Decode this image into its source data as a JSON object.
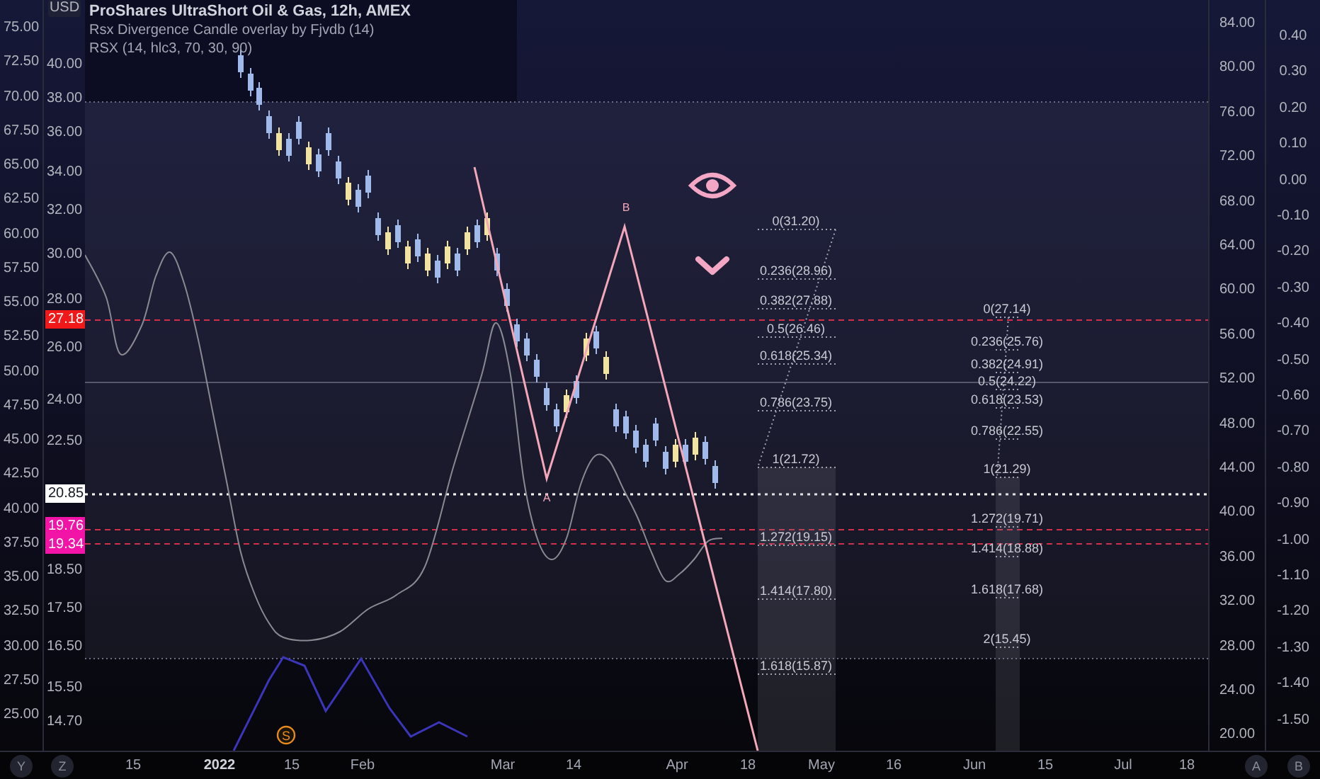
{
  "legend": {
    "title": "ProShares UltraShort Oil & Gas, 12h, AMEX",
    "indicators": [
      "Rsx Divergence Candle overlay by Fjvdb (14)",
      "RSX (14, hlc3, 70, 30, 90)"
    ]
  },
  "scale_y": {
    "button": "Y",
    "labels": [
      "75.00",
      "72.50",
      "70.00",
      "67.50",
      "65.00",
      "62.50",
      "60.00",
      "57.50",
      "55.00",
      "52.50",
      "50.00",
      "47.50",
      "45.00",
      "42.50",
      "40.00",
      "37.50",
      "35.00",
      "32.50",
      "30.00",
      "27.50",
      "25.00"
    ]
  },
  "scale_z": {
    "button": "Z",
    "currency": "USD",
    "labels": [
      "40.00",
      "38.00",
      "36.00",
      "34.00",
      "32.00",
      "30.00",
      "28.00",
      "26.00",
      "24.00",
      "22.50",
      "18.50",
      "17.50",
      "16.50",
      "15.50",
      "14.70"
    ],
    "price_tags": [
      {
        "text": "27.18",
        "color": "#f01818"
      },
      {
        "text": "20.85",
        "color": "#ffffff"
      },
      {
        "text": "19.76",
        "color": "#f214a6"
      },
      {
        "text": "19.34",
        "color": "#f214a6"
      }
    ]
  },
  "scale_a": {
    "button": "A",
    "labels": [
      "84.00",
      "80.00",
      "76.00",
      "72.00",
      "68.00",
      "64.00",
      "60.00",
      "56.00",
      "52.00",
      "48.00",
      "44.00",
      "40.00",
      "36.00",
      "32.00",
      "28.00",
      "24.00",
      "20.00"
    ]
  },
  "scale_b": {
    "button": "B",
    "labels": [
      "0.40",
      "0.30",
      "0.20",
      "0.10",
      "0.00",
      "-0.10",
      "-0.20",
      "-0.30",
      "-0.40",
      "-0.50",
      "-0.60",
      "-0.70",
      "-0.80",
      "-0.90",
      "-1.00",
      "-1.10",
      "-1.20",
      "-1.30",
      "-1.40",
      "-1.50"
    ]
  },
  "time_axis": [
    {
      "text": "15",
      "kind": "day"
    },
    {
      "text": "2022",
      "kind": "year"
    },
    {
      "text": "15",
      "kind": "day"
    },
    {
      "text": "Feb",
      "kind": "month"
    },
    {
      "text": "Mar",
      "kind": "month"
    },
    {
      "text": "14",
      "kind": "day"
    },
    {
      "text": "Apr",
      "kind": "month"
    },
    {
      "text": "18",
      "kind": "day"
    },
    {
      "text": "May",
      "kind": "month"
    },
    {
      "text": "16",
      "kind": "day"
    },
    {
      "text": "Jun",
      "kind": "month"
    },
    {
      "text": "15",
      "kind": "day"
    },
    {
      "text": "Jul",
      "kind": "month"
    },
    {
      "text": "18",
      "kind": "day"
    }
  ],
  "waves": [
    "A",
    "B"
  ],
  "event_marker": "S",
  "fib_a": [
    "0(31.20)",
    "0.236(28.96)",
    "0.382(27.88)",
    "0.5(26.46)",
    "0.618(25.34)",
    "0.786(23.75)",
    "1(21.72)",
    "1.272(19.15)",
    "1.414(17.80)",
    "1.618(15.87)"
  ],
  "fib_b": [
    "0(27.14)",
    "0.236(25.76)",
    "0.382(24.91)",
    "0.5(24.22)",
    "0.618(23.53)",
    "0.786(22.55)",
    "1(21.29)",
    "1.272(19.71)",
    "1.414(18.88)",
    "1.618(17.68)",
    "2(15.45)"
  ]
}
